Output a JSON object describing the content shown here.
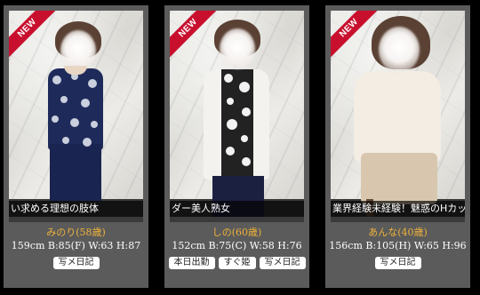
{
  "badge_text": "NEW",
  "profiles": [
    {
      "caption": "い求める理想の肢体",
      "name": "みのり(58歳)",
      "stats": "159cm B:85(F) W:63 H:87",
      "buttons": [
        "写メ日記"
      ]
    },
    {
      "caption": "ダー美人熟女",
      "name": "しの(60歳)",
      "stats": "152cm B:75(C) W:58 H:76",
      "buttons": [
        "本日出勤",
        "すぐ姫",
        "写メ日記"
      ]
    },
    {
      "caption": "業界経験未経験！魅惑のHカップ",
      "name": "あんな(40歳)",
      "stats": "156cm B:105(H) W:65 H:96",
      "buttons": [
        "写メ日記"
      ]
    }
  ],
  "colors": {
    "page_bg": "#000000",
    "card_bg": "#5b5b5b",
    "ribbon": "#c8102e",
    "name_text": "#f0b23a"
  }
}
